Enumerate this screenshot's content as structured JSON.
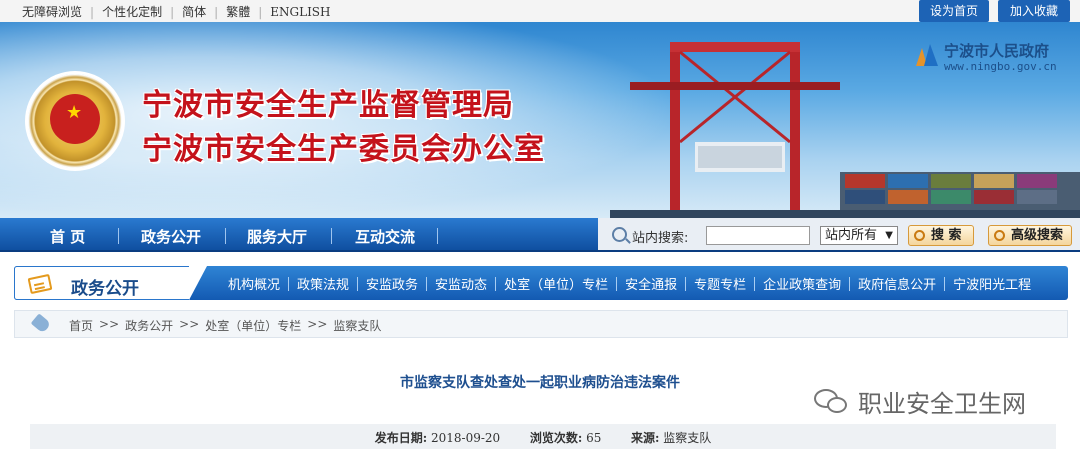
{
  "topbar": {
    "links": [
      "无障碍浏览",
      "个性化定制",
      "简体",
      "繁體",
      "ENGLISH"
    ],
    "set_home": "设为首页",
    "add_favorite": "加入收藏"
  },
  "banner": {
    "title_line1": "宁波市安全生产监督管理局",
    "title_line2": "宁波市安全生产委员会办公室",
    "gov_name": "宁波市人民政府",
    "gov_url": "www.ningbo.gov.cn"
  },
  "mainnav": {
    "items": [
      "首 页",
      "政务公开",
      "服务大厅",
      "互动交流"
    ]
  },
  "search": {
    "label": "站内搜索:",
    "input_value": "",
    "scope_selected": "站内所有",
    "search_button": "搜 索",
    "advanced_button": "高级搜索"
  },
  "section": {
    "title": "政务公开",
    "subnav": [
      "机构概况",
      "政策法规",
      "安监政务",
      "安监动态",
      "处室（单位）专栏",
      "安全通报",
      "专题专栏",
      "企业政策查询",
      "政府信息公开",
      "宁波阳光工程"
    ]
  },
  "breadcrumb": {
    "items": [
      "首页",
      "政务公开",
      "处室（单位）专栏",
      "监察支队"
    ],
    "separator": ">>"
  },
  "article": {
    "title": "市监察支队查处查处一起职业病防治违法案件",
    "publish_label": "发布日期:",
    "publish_date": "2018-09-20",
    "views_label": "浏览次数:",
    "views": "65",
    "source_label": "来源:",
    "source": "监察支队"
  },
  "watermark": {
    "text": "职业安全卫生网"
  },
  "colors": {
    "nav_blue": "#135ab2",
    "title_red": "#c4121b",
    "article_title_blue": "#1e4f8f"
  }
}
